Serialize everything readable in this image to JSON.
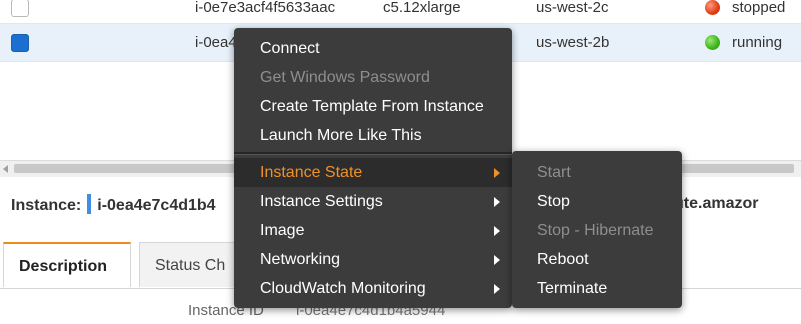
{
  "table": {
    "rows": [
      {
        "instance_id": "i-0e7e3acf4f5633aac",
        "instance_type": "c5.12xlarge",
        "availability_zone": "us-west-2c",
        "state": "stopped",
        "state_color": "#e23c12",
        "selected": false
      },
      {
        "instance_id": "i-0ea4",
        "instance_type": "",
        "availability_zone": "us-west-2b",
        "state": "running",
        "state_color": "#3db21c",
        "selected": true
      }
    ]
  },
  "details": {
    "instance_label": "Instance:",
    "instance_id": "i-0ea4e7c4d1b4",
    "public_dns_fragment": "mpute.amazor",
    "tabs": [
      {
        "label": "Description",
        "active": true
      },
      {
        "label": "Status Ch",
        "active": false
      }
    ],
    "fields": [
      {
        "label": "Instance ID",
        "value": "i-0ea4e7c4d1b4a5944"
      }
    ]
  },
  "context_menu": {
    "items": [
      {
        "label": "Connect",
        "enabled": true,
        "has_submenu": false
      },
      {
        "label": "Get Windows Password",
        "enabled": false,
        "has_submenu": false
      },
      {
        "label": "Create Template From Instance",
        "enabled": true,
        "has_submenu": false
      },
      {
        "label": "Launch More Like This",
        "enabled": true,
        "has_submenu": false
      },
      {
        "label": "Instance State",
        "enabled": true,
        "has_submenu": true,
        "highlighted": true
      },
      {
        "label": "Instance Settings",
        "enabled": true,
        "has_submenu": true
      },
      {
        "label": "Image",
        "enabled": true,
        "has_submenu": true
      },
      {
        "label": "Networking",
        "enabled": true,
        "has_submenu": true
      },
      {
        "label": "CloudWatch Monitoring",
        "enabled": true,
        "has_submenu": true
      }
    ],
    "highlight_color": "#f0902a"
  },
  "submenu": {
    "items": [
      {
        "label": "Start",
        "enabled": false
      },
      {
        "label": "Stop",
        "enabled": true
      },
      {
        "label": "Stop - Hibernate",
        "enabled": false
      },
      {
        "label": "Reboot",
        "enabled": true
      },
      {
        "label": "Terminate",
        "enabled": true
      }
    ]
  }
}
